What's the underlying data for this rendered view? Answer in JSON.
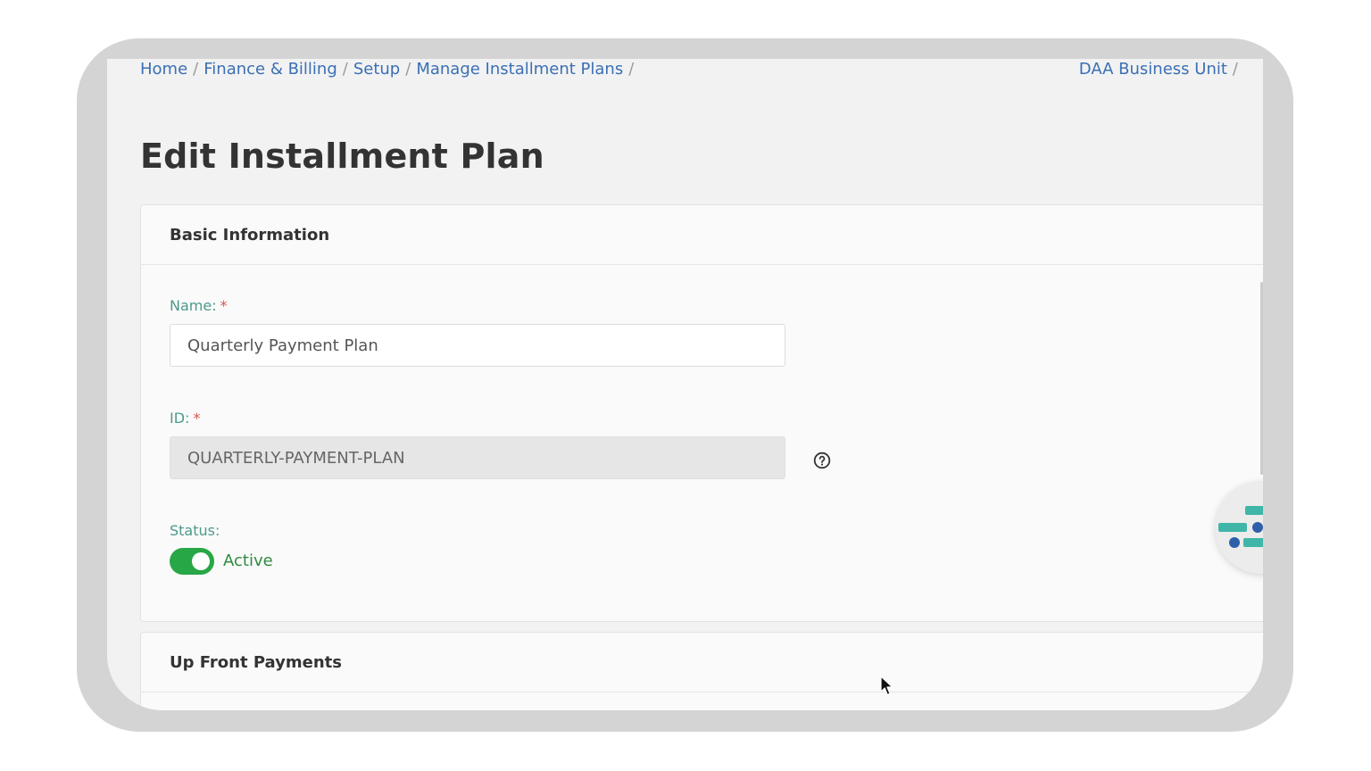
{
  "breadcrumb": {
    "items": [
      "Home",
      "Finance & Billing",
      "Setup",
      "Manage Installment Plans"
    ],
    "separator": "/"
  },
  "business_unit": {
    "label": "DAA Business Unit",
    "separator": "/"
  },
  "page": {
    "title": "Edit Installment Plan"
  },
  "basic_info": {
    "header": "Basic Information",
    "name_label": "Name:",
    "name_value": "Quarterly Payment Plan",
    "id_label": "ID:",
    "id_value": "QUARTERLY-PAYMENT-PLAN",
    "required_marker": "*",
    "status_label": "Status:",
    "status_value": "Active",
    "status_on": true
  },
  "upfront": {
    "header": "Up Front Payments"
  },
  "icons": {
    "help": "question-circle-icon",
    "fab": "filter-sliders-icon",
    "cursor": "mouse-pointer-icon"
  },
  "colors": {
    "link": "#3a6fb5",
    "label": "#4c9a8b",
    "required": "#d9534f",
    "toggle_on": "#27a745",
    "fab_teal": "#3fb6a8",
    "fab_blue": "#2f5fa8"
  }
}
